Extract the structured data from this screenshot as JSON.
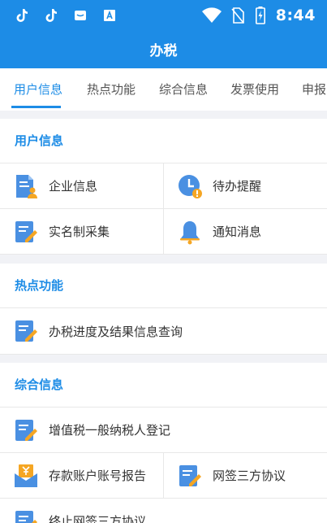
{
  "statusbar": {
    "icons_left": [
      "tiktok-icon",
      "tiktok-icon",
      "app-icon",
      "a-badge-icon"
    ],
    "time": "8:44"
  },
  "appbar": {
    "title": "办税"
  },
  "tabs": [
    {
      "label": "用户信息",
      "active": true
    },
    {
      "label": "热点功能",
      "active": false
    },
    {
      "label": "综合信息",
      "active": false
    },
    {
      "label": "发票使用",
      "active": false
    },
    {
      "label": "申报",
      "active": false
    }
  ],
  "sections": {
    "user": {
      "title": "用户信息",
      "items": [
        {
          "label": "企业信息",
          "icon": "document-user-icon"
        },
        {
          "label": "待办提醒",
          "icon": "clock-alert-icon"
        },
        {
          "label": "实名制采集",
          "icon": "edit-document-icon"
        },
        {
          "label": "通知消息",
          "icon": "bell-icon"
        }
      ]
    },
    "hot": {
      "title": "热点功能",
      "items": [
        {
          "label": "办税进度及结果信息查询",
          "icon": "edit-document-icon"
        }
      ]
    },
    "general": {
      "title": "综合信息",
      "items": [
        {
          "label": "增值税一般纳税人登记",
          "icon": "edit-document-icon"
        },
        {
          "label": "存款账户账号报告",
          "icon": "money-envelope-icon"
        },
        {
          "label": "网签三方协议",
          "icon": "edit-document-icon"
        },
        {
          "label": "终止网签三方协议",
          "icon": "edit-document-icon"
        }
      ]
    }
  },
  "colors": {
    "primary": "#1d8ce6",
    "background": "#f1f2f6",
    "icon_blue": "#4a90e2",
    "icon_orange": "#f5a623"
  }
}
